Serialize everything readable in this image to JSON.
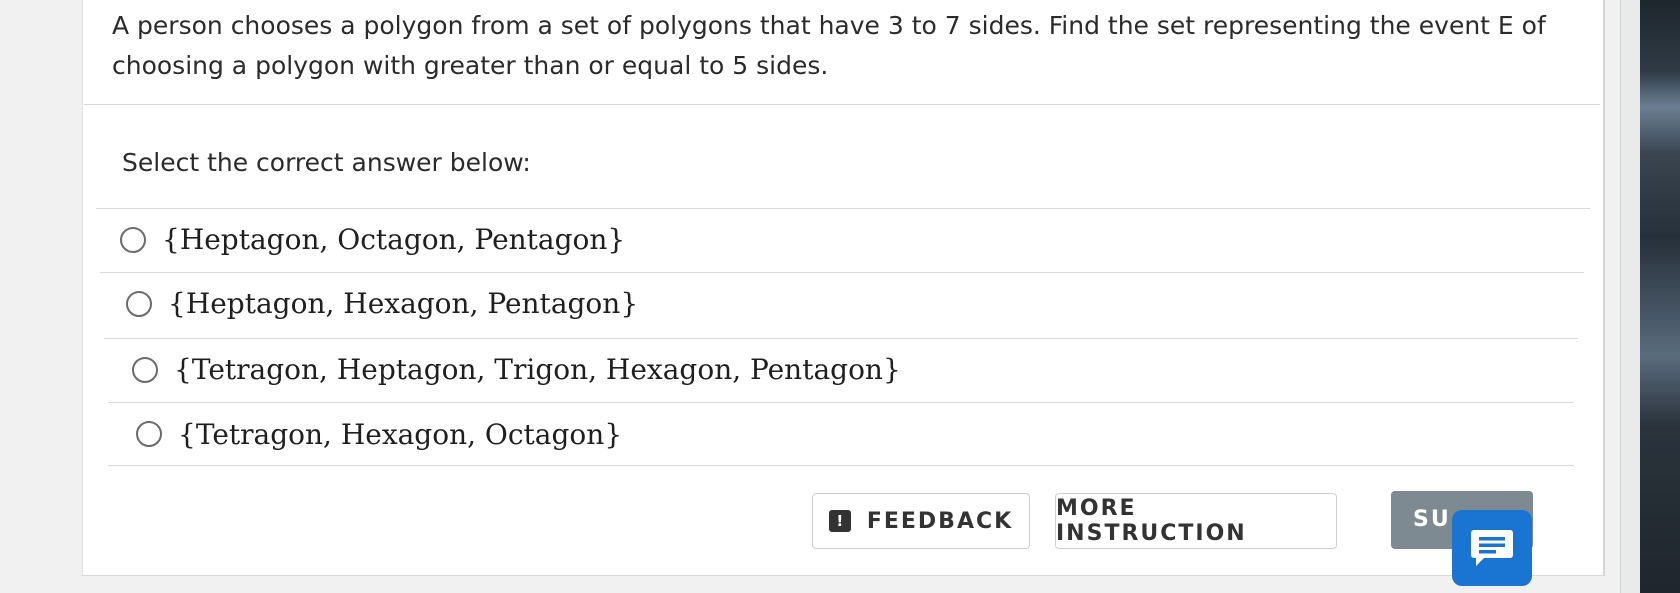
{
  "question": {
    "text": "A person chooses a polygon from a set of polygons that have 3 to 7 sides. Find the set representing the event E of choosing a polygon with greater than or equal to 5 sides."
  },
  "instruction": "Select the correct answer below:",
  "options": [
    {
      "label": "{Heptagon, Octagon, Pentagon}",
      "selected": false
    },
    {
      "label": "{Heptagon, Hexagon, Pentagon}",
      "selected": false
    },
    {
      "label": "{Tetragon, Heptagon, Trigon, Hexagon, Pentagon}",
      "selected": false
    },
    {
      "label": "{Tetragon, Hexagon, Octagon}",
      "selected": false
    }
  ],
  "buttons": {
    "feedback_label": "FEEDBACK",
    "feedback_icon": "alert-icon",
    "more_instruction_label": "MORE INSTRUCTION",
    "submit_label": "SU"
  },
  "chat": {
    "icon": "chat-icon",
    "color": "#1a75d2"
  }
}
